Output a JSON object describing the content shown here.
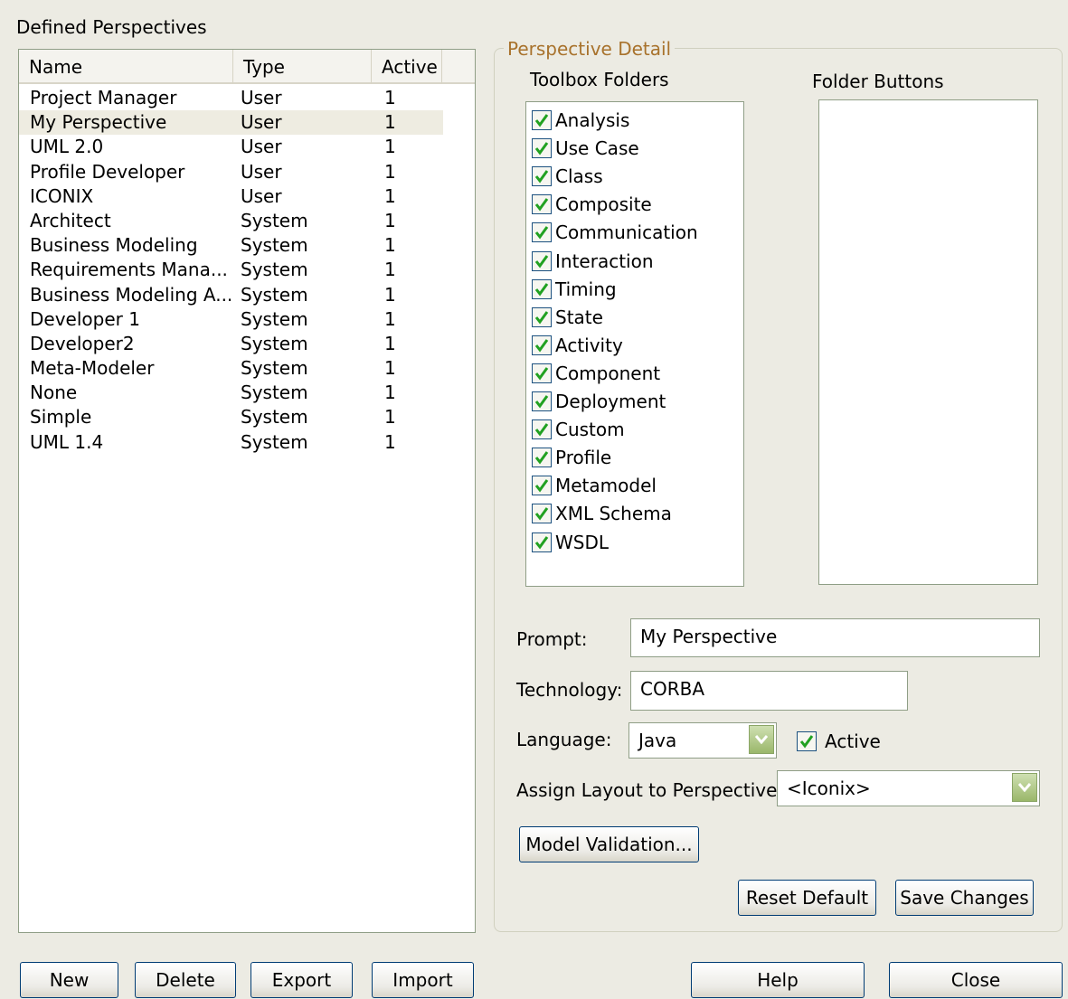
{
  "left": {
    "title": "Defined Perspectives",
    "columns": {
      "name": "Name",
      "type": "Type",
      "active": "Active"
    },
    "rows": [
      {
        "name": "Project Manager",
        "type": "User",
        "active": "1"
      },
      {
        "name": "My Perspective",
        "type": "User",
        "active": "1"
      },
      {
        "name": "UML 2.0",
        "type": "User",
        "active": "1"
      },
      {
        "name": "Profile Developer",
        "type": "User",
        "active": "1"
      },
      {
        "name": "ICONIX",
        "type": "User",
        "active": "1"
      },
      {
        "name": "Architect",
        "type": "System",
        "active": "1"
      },
      {
        "name": "Business Modeling",
        "type": "System",
        "active": "1"
      },
      {
        "name": "Requirements Mana...",
        "type": "System",
        "active": "1"
      },
      {
        "name": "Business Modeling A...",
        "type": "System",
        "active": "1"
      },
      {
        "name": "Developer 1",
        "type": "System",
        "active": "1"
      },
      {
        "name": "Developer2",
        "type": "System",
        "active": "1"
      },
      {
        "name": "Meta-Modeler",
        "type": "System",
        "active": "1"
      },
      {
        "name": "None",
        "type": "System",
        "active": "1"
      },
      {
        "name": "Simple",
        "type": "System",
        "active": "1"
      },
      {
        "name": "UML 1.4",
        "type": "System",
        "active": "1"
      }
    ]
  },
  "detail": {
    "legend": "Perspective Detail",
    "toolbox_title": "Toolbox Folders",
    "folder_buttons_title": "Folder Buttons",
    "toolbox_items": [
      {
        "label": "Analysis",
        "checked": true
      },
      {
        "label": "Use Case",
        "checked": true
      },
      {
        "label": "Class",
        "checked": true
      },
      {
        "label": "Composite",
        "checked": true
      },
      {
        "label": "Communication",
        "checked": true
      },
      {
        "label": "Interaction",
        "checked": true
      },
      {
        "label": "Timing",
        "checked": true
      },
      {
        "label": "State",
        "checked": true
      },
      {
        "label": "Activity",
        "checked": true
      },
      {
        "label": "Component",
        "checked": true
      },
      {
        "label": "Deployment",
        "checked": true
      },
      {
        "label": "Custom",
        "checked": true
      },
      {
        "label": "Profile",
        "checked": true
      },
      {
        "label": "Metamodel",
        "checked": true
      },
      {
        "label": "XML Schema",
        "checked": true
      },
      {
        "label": "WSDL",
        "checked": true
      }
    ],
    "prompt_label": "Prompt:",
    "prompt_value": "My Perspective",
    "technology_label": "Technology:",
    "technology_value": "CORBA",
    "language_label": "Language:",
    "language_value": "Java",
    "active_label": "Active",
    "active_checked": true,
    "layout_label": "Assign Layout to Perspective:",
    "layout_value": "<Iconix>",
    "model_validation": "Model Validation...",
    "reset_default": "Reset Default",
    "save_changes": "Save Changes"
  },
  "buttons": {
    "new": "New",
    "delete": "Delete",
    "export": "Export",
    "import": "Import",
    "help": "Help",
    "close": "Close"
  },
  "colors": {
    "dialog_bg": "#ecebe3",
    "legend": "#a8722c",
    "checkmark": "#21a121",
    "selection": "#eeece1"
  },
  "icons": {
    "checkbox": "check-icon",
    "dropdown": "chevron-down-icon"
  }
}
